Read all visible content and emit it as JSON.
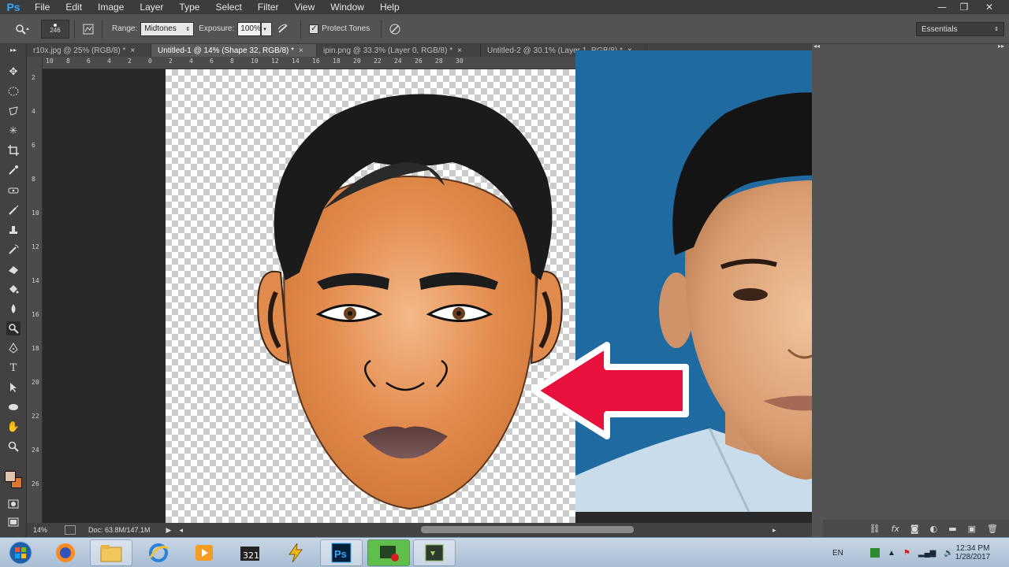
{
  "app": {
    "logo": "Ps",
    "menu": [
      "File",
      "Edit",
      "Image",
      "Layer",
      "Type",
      "Select",
      "Filter",
      "View",
      "Window",
      "Help"
    ],
    "window_controls": [
      "—",
      "❐",
      "✕"
    ]
  },
  "options": {
    "brush_size": "246",
    "range_label": "Range:",
    "range_value": "Midtones",
    "exposure_label": "Exposure:",
    "exposure_value": "100%",
    "protect_tones_label": "Protect Tones",
    "protect_tones_checked": true,
    "workspace": "Essentials"
  },
  "tabs": [
    {
      "label": "r10x.jpg @ 25% (RGB/8) *",
      "active": false
    },
    {
      "label": "Untitled-1 @ 14% (Shape 32, RGB/8) *",
      "active": true
    },
    {
      "label": "ipin.png @ 33.3% (Layer 0, RGB/8) *",
      "active": false
    },
    {
      "label": "Untitled-2 @ 30.1% (Layer 1, RGB/8) *",
      "active": false
    }
  ],
  "ruler_top": [
    "10",
    "8",
    "6",
    "4",
    "2",
    "0",
    "2",
    "4",
    "6",
    "8",
    "10",
    "12",
    "14",
    "16",
    "18",
    "20",
    "22",
    "24",
    "26",
    "28",
    "30"
  ],
  "ruler_left": [
    "2",
    "4",
    "6",
    "8",
    "10",
    "12",
    "14",
    "16",
    "18",
    "20",
    "22",
    "24",
    "26"
  ],
  "status": {
    "zoom": "14%",
    "doc": "Doc: 63.8M/147.1M"
  },
  "taskbar": {
    "language": "EN",
    "time": "12:34 PM",
    "date": "1/28/2017"
  },
  "colors": {
    "accent": "#31a8ff",
    "arrow": "#e8113e",
    "photo_bg": "#1f6aa0",
    "skin": "#e08a4e"
  }
}
